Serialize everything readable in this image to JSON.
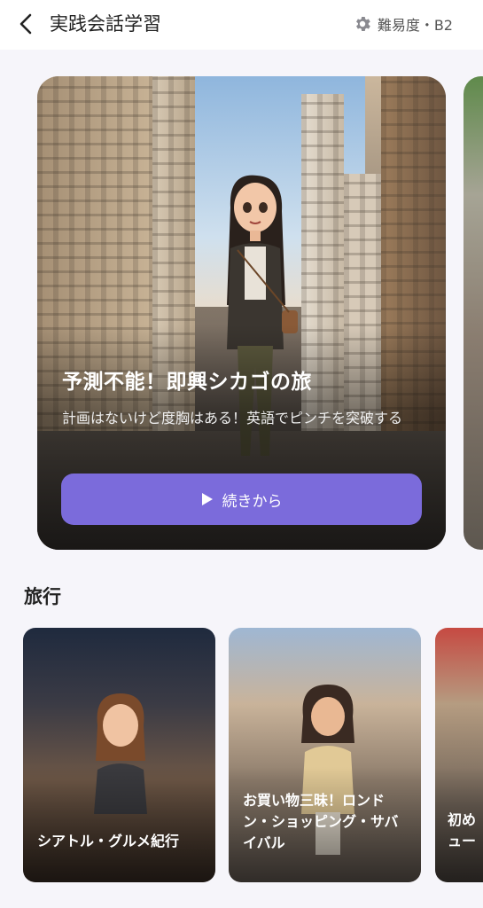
{
  "header": {
    "title": "実践会話学習",
    "difficulty_label": "難易度・B2"
  },
  "hero": {
    "title": "予測不能！即興シカゴの旅",
    "description": "計画はないけど度胸はある！英語でピンチを突破する",
    "continue_label": "続きから"
  },
  "section": {
    "title": "旅行"
  },
  "cards": [
    {
      "label": "シアトル・グルメ紀行"
    },
    {
      "label": "お買い物三昧！ロンドン・ショッピング・サバイバル"
    },
    {
      "label": "初め\nュー"
    }
  ],
  "colors": {
    "accent": "#7b6bdb",
    "background": "#f6f5fa"
  },
  "icons": {
    "back": "chevron-left-icon",
    "settings": "gear-icon",
    "play": "play-icon"
  }
}
